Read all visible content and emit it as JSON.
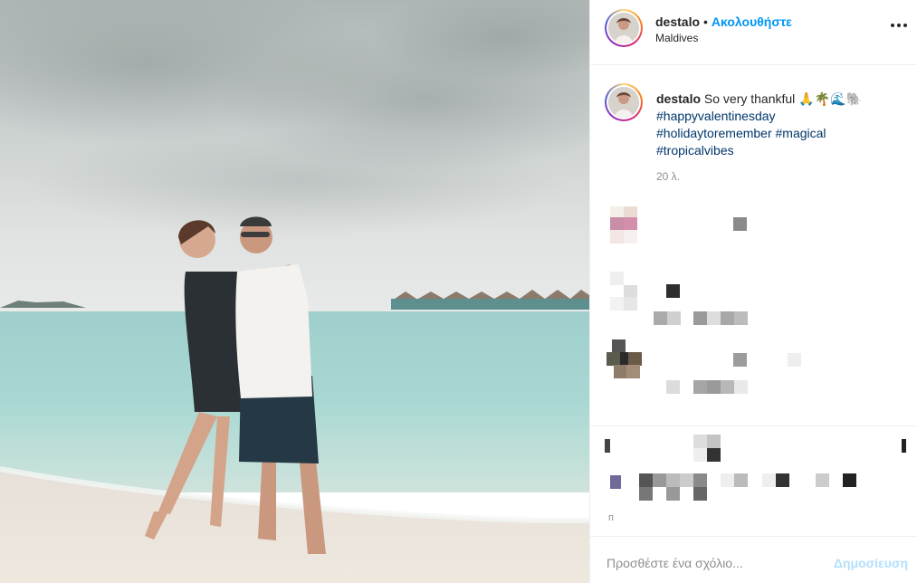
{
  "post": {
    "username": "destalo",
    "follow_label": "Ακολουθήστε",
    "location": "Maldives",
    "caption_text": "So very thankful 🙏🌴🌊🐘",
    "hashtags": [
      "#happyvalentinesday",
      "#holidaytoremember",
      "#magical",
      "#tropicalvibes"
    ],
    "time_ago": "20 λ.",
    "photo_alt_icon": "photo-couple-beach"
  },
  "comment_box": {
    "placeholder": "Προσθέστε ένα σχόλιο...",
    "post_label": "Δημοσίευση"
  },
  "icons": {
    "more": "more-options-icon"
  },
  "colors": {
    "follow": "#0095f6",
    "hashtag": "#00376b",
    "post_disabled": "#b2dffc",
    "text": "#262626",
    "muted": "#8e8e8e"
  }
}
